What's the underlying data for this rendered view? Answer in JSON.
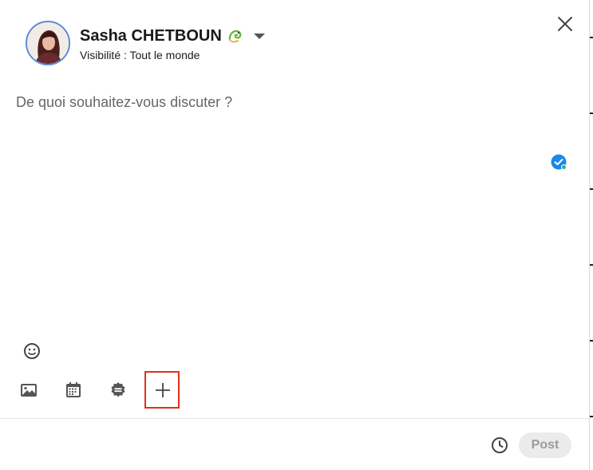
{
  "header": {
    "user_name": "Sasha CHETBOUN",
    "visibility_label": "Visibilité : Tout le monde"
  },
  "composer": {
    "placeholder": "De quoi souhaitez-vous discuter ?",
    "value": ""
  },
  "toolbar": {
    "items": [
      {
        "icon": "image-icon"
      },
      {
        "icon": "calendar-icon"
      },
      {
        "icon": "badge-icon"
      },
      {
        "icon": "plus-icon"
      }
    ]
  },
  "footer": {
    "post_label": "Post"
  },
  "colors": {
    "highlight": "#e0321b",
    "avatar_ring": "#5b8ad6",
    "post_disabled_bg": "#ebebeb",
    "grammar_badge": "#1e88e5"
  }
}
